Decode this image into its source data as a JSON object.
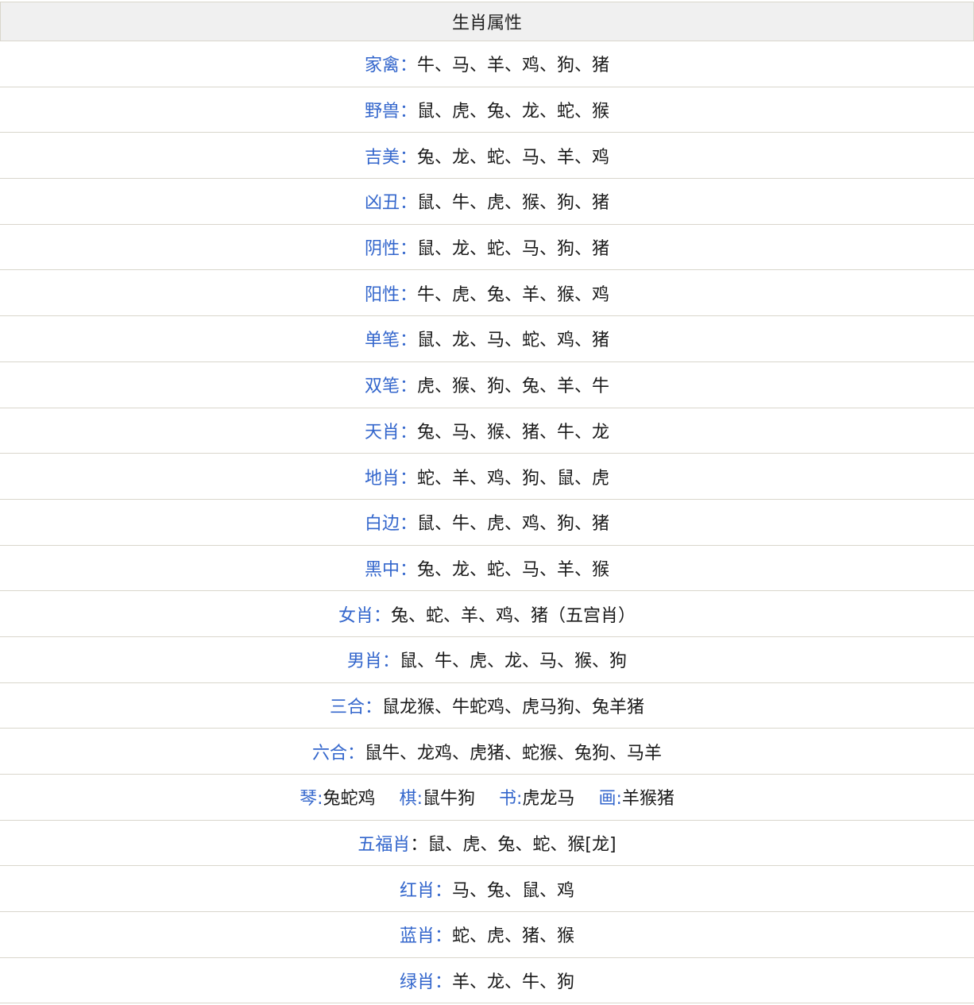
{
  "table": {
    "header": "生肖属性",
    "rows": [
      {
        "label": "家禽：",
        "value": "牛、马、羊、鸡、狗、猪"
      },
      {
        "label": "野兽：",
        "value": "鼠、虎、兔、龙、蛇、猴"
      },
      {
        "label": "吉美：",
        "value": "兔、龙、蛇、马、羊、鸡"
      },
      {
        "label": "凶丑：",
        "value": "鼠、牛、虎、猴、狗、猪"
      },
      {
        "label": "阴性：",
        "value": "鼠、龙、蛇、马、狗、猪"
      },
      {
        "label": "阳性：",
        "value": "牛、虎、兔、羊、猴、鸡"
      },
      {
        "label": "单笔：",
        "value": "鼠、龙、马、蛇、鸡、猪"
      },
      {
        "label": "双笔：",
        "value": "虎、猴、狗、兔、羊、牛"
      },
      {
        "label": "天肖：",
        "value": "兔、马、猴、猪、牛、龙"
      },
      {
        "label": "地肖：",
        "value": "蛇、羊、鸡、狗、鼠、虎"
      },
      {
        "label": "白边：",
        "value": "鼠、牛、虎、鸡、狗、猪"
      },
      {
        "label": "黑中：",
        "value": "兔、龙、蛇、马、羊、猴"
      },
      {
        "label": "女肖：",
        "value": "兔、蛇、羊、鸡、猪（五宫肖）"
      },
      {
        "label": "男肖：",
        "value": "鼠、牛、虎、龙、马、猴、狗"
      },
      {
        "label": "三合：",
        "value": "鼠龙猴、牛蛇鸡、虎马狗、兔羊猪"
      },
      {
        "label": "六合：",
        "value": "鼠牛、龙鸡、虎猪、蛇猴、兔狗、马羊"
      }
    ],
    "arts_row": [
      {
        "label": "琴:",
        "value": "兔蛇鸡"
      },
      {
        "label": "棋:",
        "value": "鼠牛狗"
      },
      {
        "label": "书:",
        "value": "虎龙马"
      },
      {
        "label": "画:",
        "value": "羊猴猪"
      }
    ],
    "rows_after": [
      {
        "label": "五福肖",
        "value": "：鼠、虎、兔、蛇、猴[龙]"
      },
      {
        "label": "红肖：",
        "value": "马、兔、鼠、鸡"
      },
      {
        "label": "蓝肖：",
        "value": "蛇、虎、猪、猴"
      },
      {
        "label": "绿肖：",
        "value": "羊、龙、牛、狗"
      }
    ]
  },
  "colors": {
    "label": "#3366cc",
    "text": "#1a1a1a",
    "header_bg": "#f0f0f0",
    "border": "#d9d6cc"
  }
}
